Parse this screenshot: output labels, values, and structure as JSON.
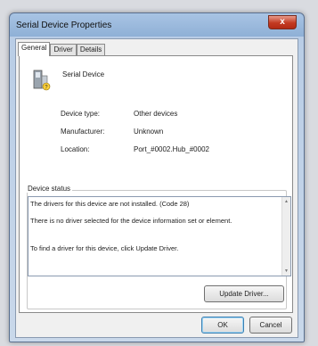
{
  "window": {
    "title": "Serial Device Properties",
    "close_label": "x"
  },
  "tabs": [
    {
      "label": "General",
      "active": true
    },
    {
      "label": "Driver",
      "active": false
    },
    {
      "label": "Details",
      "active": false
    }
  ],
  "device": {
    "icon": "serial-device-icon",
    "name": "Serial Device",
    "properties": [
      {
        "label": "Device type:",
        "value": "Other devices"
      },
      {
        "label": "Manufacturer:",
        "value": "Unknown"
      },
      {
        "label": "Location:",
        "value": "Port_#0002.Hub_#0002"
      }
    ]
  },
  "device_status": {
    "label": "Device status",
    "lines": [
      "The drivers for this device are not installed. (Code 28)",
      "There is no driver selected for the device information set or element.",
      "To find a driver for this device, click Update Driver."
    ]
  },
  "buttons": {
    "update_driver": "Update Driver...",
    "ok": "OK",
    "cancel": "Cancel"
  }
}
